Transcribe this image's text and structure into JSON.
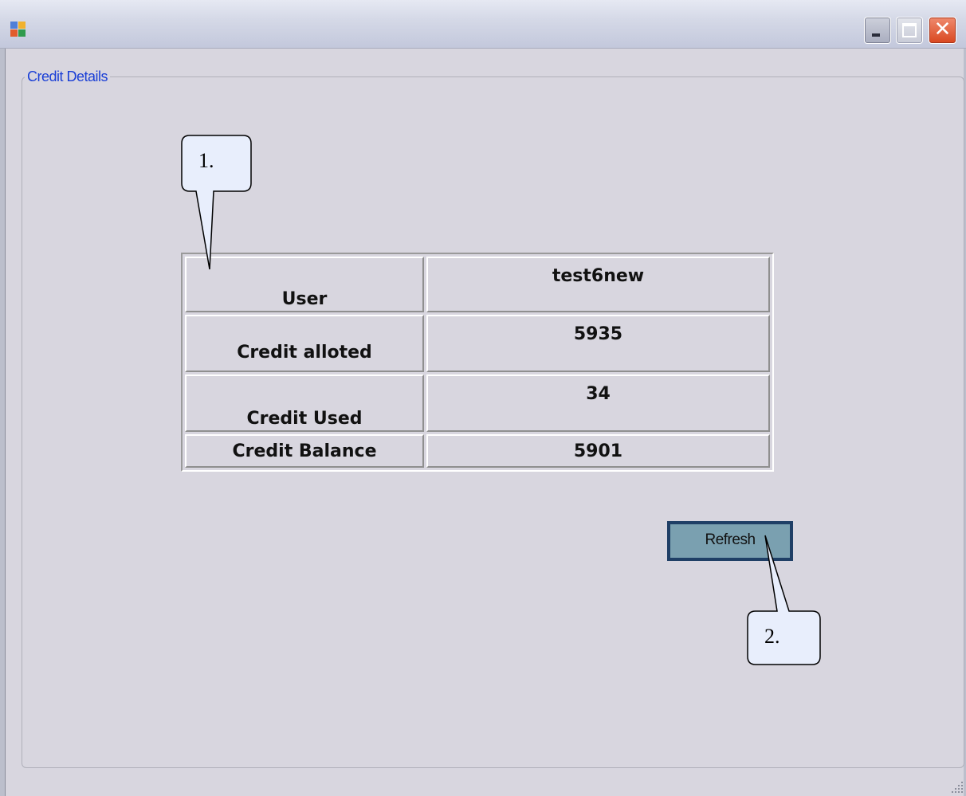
{
  "window": {
    "controls": {
      "minimize_icon": "minimize-icon",
      "maximize_icon": "maximize-icon",
      "close_icon": "close-icon",
      "close_glyph": "✕"
    }
  },
  "group": {
    "title": "Credit Details"
  },
  "credit_table": {
    "rows": [
      {
        "label": "User",
        "value": "test6new"
      },
      {
        "label": "Credit alloted",
        "value": "5935"
      },
      {
        "label": "Credit Used",
        "value": "34"
      },
      {
        "label": "Credit Balance",
        "value": "5901"
      }
    ]
  },
  "actions": {
    "refresh_label": "Refresh"
  },
  "callouts": [
    {
      "label": "1."
    },
    {
      "label": "2."
    }
  ],
  "colors": {
    "window_bg": "#d8d6df",
    "legend_text": "#1a3fd6",
    "button_bg": "#7aa0b0",
    "button_border": "#1f3f66",
    "callout_fill": "#e8eefc"
  }
}
